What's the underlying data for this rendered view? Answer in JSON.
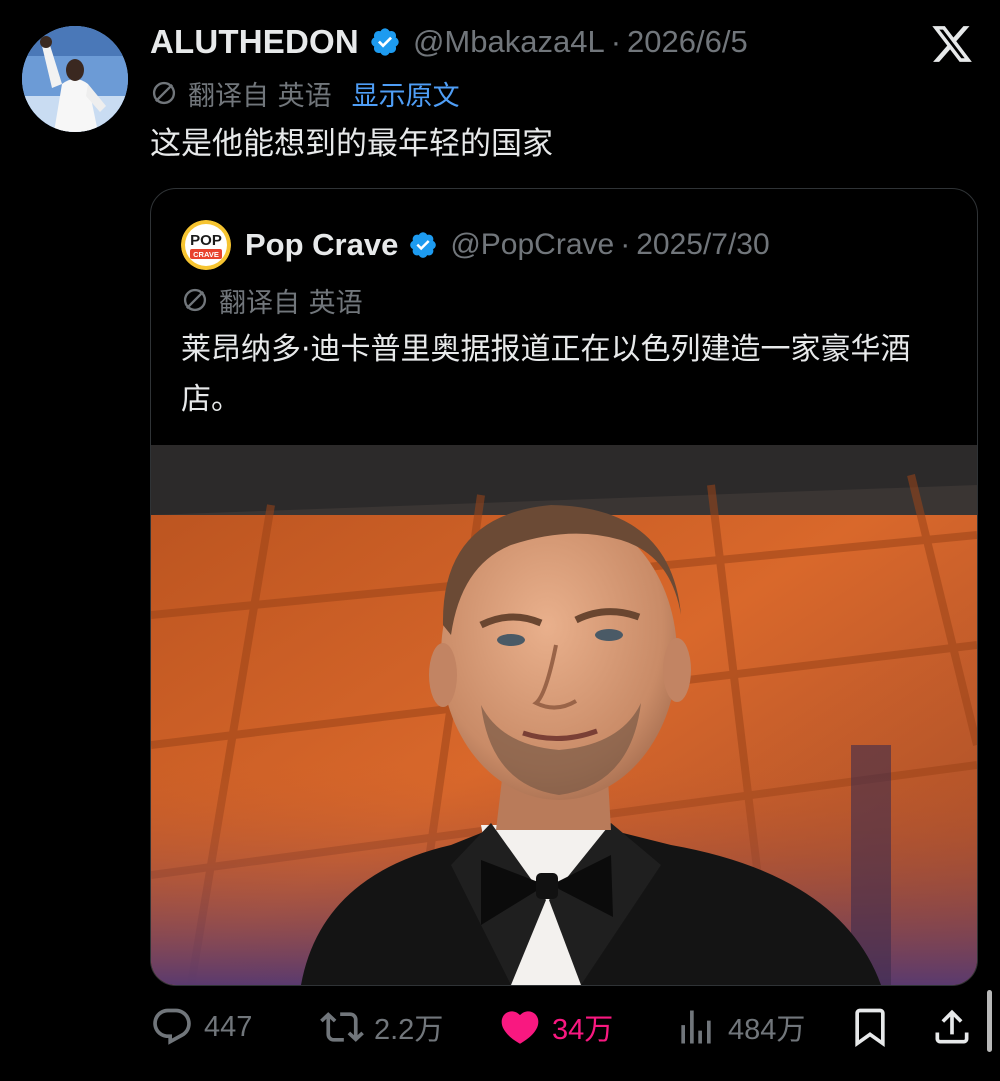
{
  "app": {
    "logo_icon": "x-logo-icon"
  },
  "tweet": {
    "display_name": "ALUTHEDON",
    "handle": "@Mbakaza4L",
    "separator": "·",
    "date": "2026/6/5",
    "translated_label": "翻译自 英语",
    "show_original": "显示原文",
    "text": "这是他能想到的最年轻的国家",
    "verified_icon": "verified-badge-icon",
    "accent_color": "#1d9bf0",
    "link_color": "#4f9ef6"
  },
  "quote": {
    "display_name": "Pop Crave",
    "handle": "@PopCrave",
    "separator": "·",
    "date": "2025/7/30",
    "translated_label": "翻译自 英语",
    "logo_line1": "POP",
    "logo_line2": "CRAVE",
    "text": "莱昂纳多·迪卡普里奥据报道正在以色列建造一家豪华酒店。",
    "photo_icon": "portrait-photo"
  },
  "actions": {
    "replies": "447",
    "reposts": "2.2万",
    "likes": "34万",
    "views": "484万",
    "like_color": "#f91880",
    "icons": [
      "reply-icon",
      "repost-icon",
      "like-icon",
      "views-icon",
      "bookmark-icon",
      "share-icon"
    ]
  }
}
